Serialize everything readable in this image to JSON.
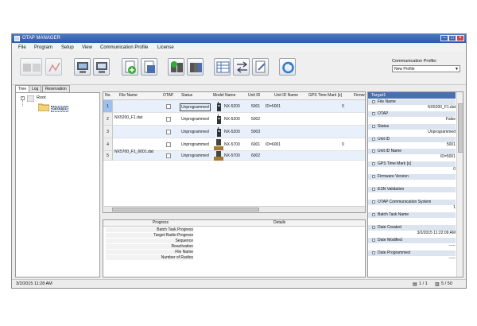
{
  "window": {
    "title": "OTAP MANAGER"
  },
  "menu": [
    "File",
    "Program",
    "Setup",
    "View",
    "Communication Profile",
    "License"
  ],
  "comm_profile": {
    "label": "Communication Profile:",
    "value": "New Profile"
  },
  "tabs": [
    "Tree",
    "Log",
    "Reservation"
  ],
  "tree": {
    "root": "Root",
    "group": "Group1"
  },
  "grid": {
    "columns": [
      "No.",
      "File Name",
      "OTAP",
      "Status",
      "Model Name",
      "Unit ID",
      "Unit ID Name",
      "GPS Time Mark [s]",
      "Firmw"
    ],
    "rows": [
      {
        "no": "1",
        "file": "",
        "status": "Unprogrammed",
        "model": "NX-5200",
        "unit_id": "5001",
        "unit_name": "ID=5001",
        "gps": "0"
      },
      {
        "no": "2",
        "file": "NX5200_F1.dat",
        "status": "Unprogrammed",
        "model": "NX-5200",
        "unit_id": "5002",
        "unit_name": "",
        "gps": ""
      },
      {
        "no": "3",
        "file": "",
        "status": "Unprogrammed",
        "model": "NX-5200",
        "unit_id": "5003",
        "unit_name": "",
        "gps": ""
      },
      {
        "no": "4",
        "file": "",
        "status": "Unprogrammed",
        "model": "NX-5700",
        "unit_id": "6001",
        "unit_name": "ID=6001",
        "gps": "0"
      },
      {
        "no": "5",
        "file": "NX5700_F1_6001.dat",
        "status": "Unprogrammed",
        "model": "NX-5700",
        "unit_id": "6002",
        "unit_name": "",
        "gps": ""
      }
    ]
  },
  "progress": {
    "headers": [
      "Progress",
      "Details"
    ],
    "labels": [
      "Batch Task Progress",
      "Target Radio Progress",
      "Sequence",
      "Reactivation",
      "File Name",
      "Number of Radios"
    ]
  },
  "properties": {
    "title": "Target1",
    "items": [
      {
        "name": "File Name",
        "value": "NX5200_F1.dat"
      },
      {
        "name": "OTAP",
        "value": "False"
      },
      {
        "name": "Status",
        "value": "Unprogrammed"
      },
      {
        "name": "Unit ID",
        "value": "5001"
      },
      {
        "name": "Unit ID Name",
        "value": "ID=5001"
      },
      {
        "name": "GPS Time Mark [s]",
        "value": "0"
      },
      {
        "name": "Firmware Version",
        "value": ""
      },
      {
        "name": "ESN Validation",
        "value": ""
      },
      {
        "name": "OTAP Communication System",
        "value": "1"
      },
      {
        "name": "Batch Task Name",
        "value": ""
      },
      {
        "name": "Date Created",
        "value": "3/2/2015 11:22:09 AM"
      },
      {
        "name": "Date Modified",
        "value": "-----"
      },
      {
        "name": "Date Programmed",
        "value": "-----"
      }
    ]
  },
  "statusbar": {
    "datetime": "3/2/2015 11:28 AM",
    "page": "1 / 1",
    "count": "5 / 50"
  }
}
